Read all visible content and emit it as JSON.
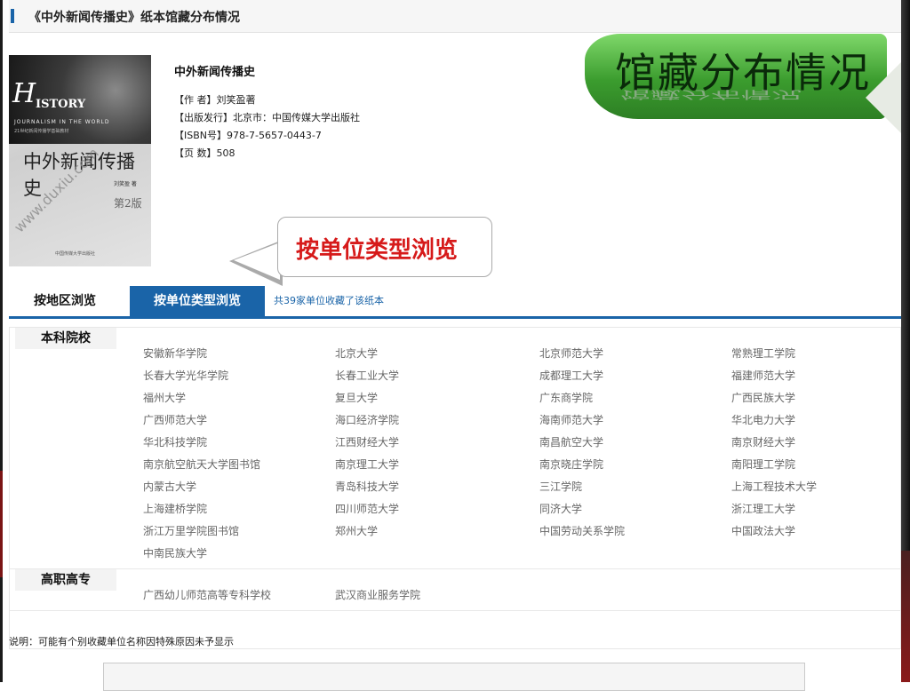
{
  "page_title": "《中外新闻传播史》纸本馆藏分布情况",
  "cover": {
    "h_letter": "H",
    "istory": "ISTORY",
    "subtitle_en": "JOURNALISM IN THE WORLD",
    "series_line": "21世纪新闻传播学基础教材",
    "title_cn": "中外新闻传播史",
    "author": "刘笑盈  著",
    "edition": "第2版",
    "publisher": "中国传媒大学出版社",
    "watermark": "www.duxiu.com"
  },
  "book": {
    "name": "中外新闻传播史",
    "fields": [
      {
        "label": "【作  者】",
        "value": "刘笑盈著"
      },
      {
        "label": "【出版发行】",
        "value": "北京市：中国传媒大学出版社"
      },
      {
        "label": "【ISBN号】",
        "value": "978-7-5657-0443-7"
      },
      {
        "label": "【页  数】",
        "value": "508"
      }
    ]
  },
  "ribbon_title": "馆藏分布情况",
  "callout_text": "按单位类型浏览",
  "tabs": {
    "by_region": "按地区浏览",
    "by_type": "按单位类型浏览",
    "count_text": "共39家单位收藏了该纸本"
  },
  "sections": [
    {
      "heading": "本科院校",
      "institutions": [
        "安徽新华学院",
        "北京大学",
        "北京师范大学",
        "常熟理工学院",
        "长春大学光华学院",
        "长春工业大学",
        "成都理工大学",
        "福建师范大学",
        "福州大学",
        "复旦大学",
        "广东商学院",
        "广西民族大学",
        "广西师范大学",
        "海口经济学院",
        "海南师范大学",
        "华北电力大学",
        "华北科技学院",
        "江西财经大学",
        "南昌航空大学",
        "南京财经大学",
        "南京航空航天大学图书馆",
        "南京理工大学",
        "南京晓庄学院",
        "南阳理工学院",
        "内蒙古大学",
        "青岛科技大学",
        "三江学院",
        "上海工程技术大学",
        "上海建桥学院",
        "四川师范大学",
        "同济大学",
        "浙江理工大学",
        "浙江万里学院图书馆",
        "郑州大学",
        "中国劳动关系学院",
        "中国政法大学",
        "中南民族大学"
      ]
    },
    {
      "heading": "高职高专",
      "institutions": [
        "广西幼儿师范高等专科学校",
        "武汉商业服务学院"
      ]
    }
  ],
  "note": "说明：可能有个别收藏单位名称因特殊原因未予显示",
  "colors": {
    "accent": "#1a64a8",
    "callout_text": "#d61a1a",
    "ribbon_green": "#3b9c2e"
  }
}
